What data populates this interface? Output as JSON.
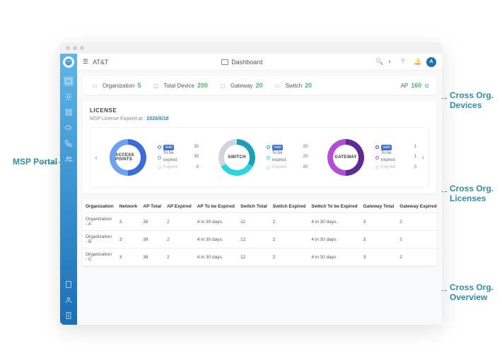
{
  "header": {
    "tenant": "AT&T",
    "page": "Dashboard",
    "avatar_initial": "A"
  },
  "stats": {
    "org": {
      "label": "Organization",
      "value": "5"
    },
    "total": {
      "label": "Total Device",
      "value": "200"
    },
    "gateway": {
      "label": "Gateway",
      "value": "20"
    },
    "switch": {
      "label": "Switch",
      "value": "20"
    },
    "ap": {
      "label": "AP",
      "value": "160"
    }
  },
  "license": {
    "title": "LICENSE",
    "expired_label": "MSP License Expired at :",
    "expired_date": "2026/6/18",
    "status_labels": {
      "valid": "Valid",
      "to_be_expired": "To be expired",
      "expired": "Expired"
    },
    "cards": [
      {
        "title": "ACCESS POINTS",
        "color1": "#3a6dd8",
        "color2": "#6ea1f0",
        "valid": 30,
        "to_be_expired": 30,
        "expired": 0
      },
      {
        "title": "SWITCH",
        "color1": "#17a2b8",
        "color2": "#2bd5de",
        "valid": 20,
        "to_be_expired": 20,
        "expired": 20
      },
      {
        "title": "GATEWAY",
        "color1": "#5b2c91",
        "color2": "#b54dd8",
        "valid": 1,
        "to_be_expired": 1,
        "expired": 0
      }
    ]
  },
  "table": {
    "headers": [
      "Organization",
      "Network",
      "AP Total",
      "AP Expired",
      "AP To be Expired",
      "Switch Total",
      "Switch Expired",
      "Switch To be Expired",
      "Gateway Total",
      "Gateway Expired"
    ],
    "rows": [
      [
        "Organization - A",
        "3",
        "38",
        "2",
        "4 in 30 days.",
        "12",
        "2",
        "4 in 30 days.",
        "3",
        "2"
      ],
      [
        "Organization - B",
        "3",
        "38",
        "2",
        "4 in 30 days.",
        "12",
        "2",
        "4 in 30 days.",
        "3",
        "2"
      ],
      [
        "Organization - C",
        "3",
        "38",
        "2",
        "4 in 30 days.",
        "12",
        "2",
        "4 in 30 days",
        "3",
        "2"
      ]
    ]
  },
  "annotations": {
    "msp": "MSP Portal",
    "devices": "Cross Org. Devices",
    "licenses": "Cross Org. Licenses",
    "overview": "Cross Org. Overview"
  },
  "chart_data": [
    {
      "type": "pie",
      "title": "ACCESS POINTS",
      "series": [
        {
          "name": "Valid",
          "value": 30
        },
        {
          "name": "To be expired",
          "value": 30
        },
        {
          "name": "Expired",
          "value": 0
        }
      ]
    },
    {
      "type": "pie",
      "title": "SWITCH",
      "series": [
        {
          "name": "Valid",
          "value": 20
        },
        {
          "name": "To be expired",
          "value": 20
        },
        {
          "name": "Expired",
          "value": 20
        }
      ]
    },
    {
      "type": "pie",
      "title": "GATEWAY",
      "series": [
        {
          "name": "Valid",
          "value": 1
        },
        {
          "name": "To be expired",
          "value": 1
        },
        {
          "name": "Expired",
          "value": 0
        }
      ]
    }
  ]
}
